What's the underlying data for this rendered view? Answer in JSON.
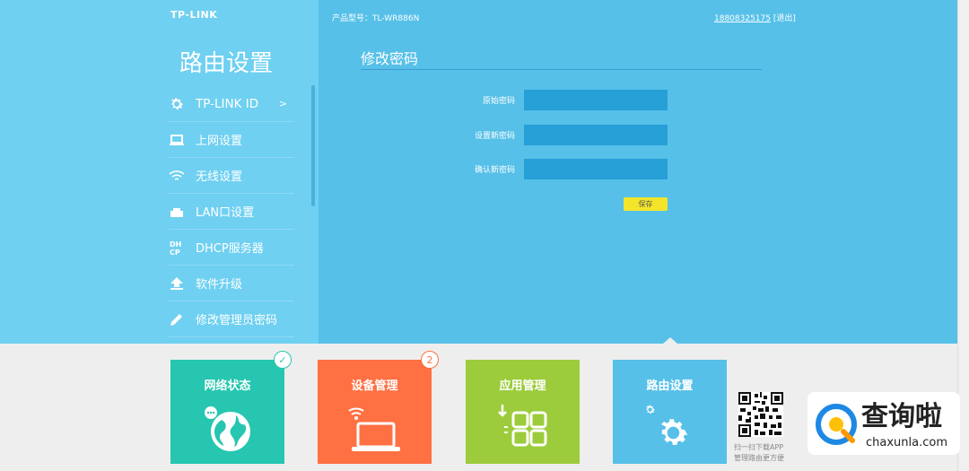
{
  "header": {
    "logo": "TP-LINK",
    "model_label": "产品型号：TL-WR886N",
    "account": "18808325175",
    "logout": "[退出]"
  },
  "sidebar": {
    "title": "路由设置",
    "items": [
      {
        "label": "TP-LINK ID",
        "icon": "gear-icon",
        "arrow": ">"
      },
      {
        "label": "上网设置",
        "icon": "laptop-icon"
      },
      {
        "label": "无线设置",
        "icon": "wifi-icon"
      },
      {
        "label": "LAN口设置",
        "icon": "lan-port-icon"
      },
      {
        "label": "DHCP服务器",
        "icon": "dhcp-icon"
      },
      {
        "label": "软件升级",
        "icon": "upload-icon"
      },
      {
        "label": "修改管理员密码",
        "icon": "pencil-icon"
      }
    ]
  },
  "main": {
    "title": "修改密码",
    "fields": [
      {
        "label": "原始密码",
        "value": ""
      },
      {
        "label": "设置新密码",
        "value": ""
      },
      {
        "label": "确认新密码",
        "value": ""
      }
    ],
    "save_label": "保存"
  },
  "tiles": [
    {
      "label": "网络状态",
      "color": "#26c6b0",
      "icon": "globe-icon",
      "badge": "✓",
      "badge_color": "#26c6b0"
    },
    {
      "label": "设备管理",
      "color": "#ff7043",
      "icon": "laptop-wifi-icon",
      "badge": "2",
      "badge_color": "#ff7043"
    },
    {
      "label": "应用管理",
      "color": "#9ccc3c",
      "icon": "apps-grid-icon"
    },
    {
      "label": "路由设置",
      "color": "#56c0e8",
      "icon": "gears-icon"
    }
  ],
  "qr": {
    "line1": "扫一扫下载APP",
    "line2": "管理路由更方便"
  },
  "watermark": {
    "text": "查询啦",
    "domain": "chaxunla.com"
  }
}
